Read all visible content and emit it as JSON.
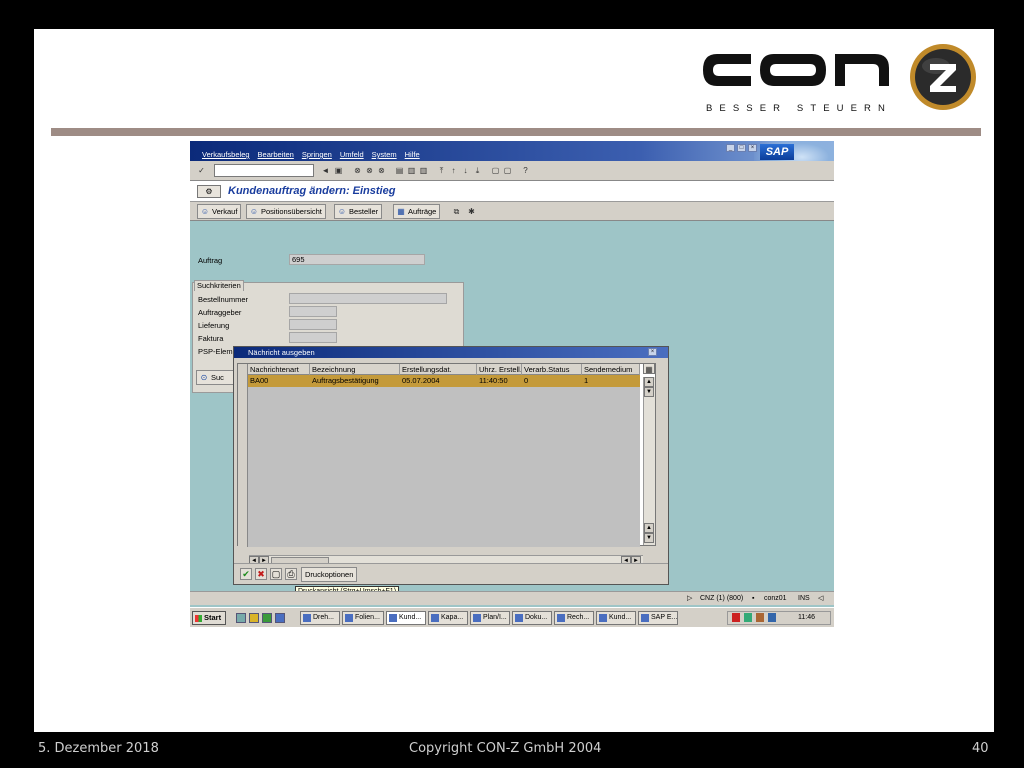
{
  "footer": {
    "date": "5. Dezember 2018",
    "copyright": "Copyright CON-Z GmbH 2004",
    "page_number": "40"
  },
  "logo": {
    "wordmark": "con",
    "circle_letter": "z",
    "tagline": "BESSER STEUERN"
  },
  "sap": {
    "menu": [
      "Verkaufsbeleg",
      "Bearbeiten",
      "Springen",
      "Umfeld",
      "System",
      "Hilfe"
    ],
    "logo_text": "SAP",
    "screen_title": "Kundenauftrag ändern: Einstieg",
    "app_toolbar": {
      "verkauf": "Verkauf",
      "positionsuebersicht": "Positionsübersicht",
      "besteller": "Besteller",
      "auftraege": "Aufträge"
    },
    "auftrag_label": "Auftrag",
    "auftrag_value": "695",
    "search_tab": "Suchkriterien",
    "search_fields": [
      "Bestellnummer",
      "Auftraggeber",
      "Lieferung",
      "Faktura",
      "PSP-Elem"
    ],
    "search_button_label": "Suc",
    "dialog": {
      "title": "Nächricht ausgeben",
      "columns": [
        "Nachrichtenart",
        "Bezeichnung",
        "Erstellungsdat.",
        "Uhrz. Erstell.",
        "Verarb.Status",
        "Sendemedium"
      ],
      "rows": [
        [
          "BA00",
          "Auftragsbestätigung",
          "05.07.2004",
          "11:40:50",
          "0",
          "1"
        ]
      ],
      "druckoptionen": "Druckoptionen",
      "tooltip": "Druckansicht  (Strg+Umsch+F1)"
    },
    "status": {
      "system": "CNZ (1) (800)",
      "user": "conz01",
      "mode": "INS"
    },
    "taskbar": {
      "start": "Start",
      "tasks": [
        "Dreh...",
        "Folien...",
        "Kund...",
        "Kapa...",
        "Plan/I...",
        "Doku...",
        "Rech...",
        "Kund...",
        "SAP E..."
      ],
      "clock": "11:46"
    }
  }
}
